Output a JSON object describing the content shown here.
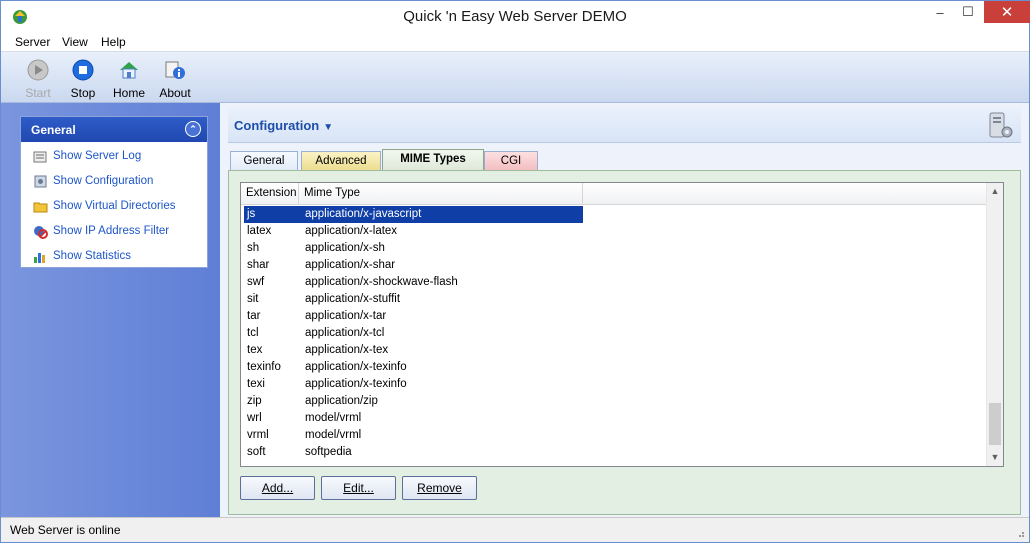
{
  "window": {
    "title": "Quick 'n Easy Web Server DEMO",
    "controls": {
      "minimize": "–",
      "maximize": "☐",
      "close": "✕"
    }
  },
  "menu": [
    "Server",
    "View",
    "Help"
  ],
  "toolbar": {
    "start": "Start",
    "stop": "Stop",
    "home": "Home",
    "about": "About"
  },
  "sidebar": {
    "header": "General",
    "items": [
      {
        "label": "Show Server Log",
        "icon": "log-icon"
      },
      {
        "label": "Show Configuration",
        "icon": "config-icon"
      },
      {
        "label": "Show Virtual Directories",
        "icon": "folder-icon"
      },
      {
        "label": "Show IP Address Filter",
        "icon": "filter-icon"
      },
      {
        "label": "Show Statistics",
        "icon": "chart-icon"
      }
    ]
  },
  "config": {
    "title": "Configuration",
    "tabs": [
      "General",
      "Advanced",
      "MIME Types",
      "CGI"
    ],
    "active_tab": "MIME Types",
    "columns": [
      "Extension",
      "Mime Type"
    ],
    "rows": [
      [
        "js",
        "application/x-javascript"
      ],
      [
        "latex",
        "application/x-latex"
      ],
      [
        "sh",
        "application/x-sh"
      ],
      [
        "shar",
        "application/x-shar"
      ],
      [
        "swf",
        "application/x-shockwave-flash"
      ],
      [
        "sit",
        "application/x-stuffit"
      ],
      [
        "tar",
        "application/x-tar"
      ],
      [
        "tcl",
        "application/x-tcl"
      ],
      [
        "tex",
        "application/x-tex"
      ],
      [
        "texinfo",
        "application/x-texinfo"
      ],
      [
        "texi",
        "application/x-texinfo"
      ],
      [
        "zip",
        "application/zip"
      ],
      [
        "wrl",
        "model/vrml"
      ],
      [
        "vrml",
        "model/vrml"
      ],
      [
        "soft",
        "softpedia"
      ]
    ],
    "selected_row": 0,
    "buttons": {
      "add": "Add...",
      "edit": "Edit...",
      "remove": "Remove"
    }
  },
  "status": {
    "text": "Web Server is online"
  },
  "colors": {
    "accent": "#2048b0",
    "selection": "#0f3fa6",
    "link": "#1d56c8"
  }
}
